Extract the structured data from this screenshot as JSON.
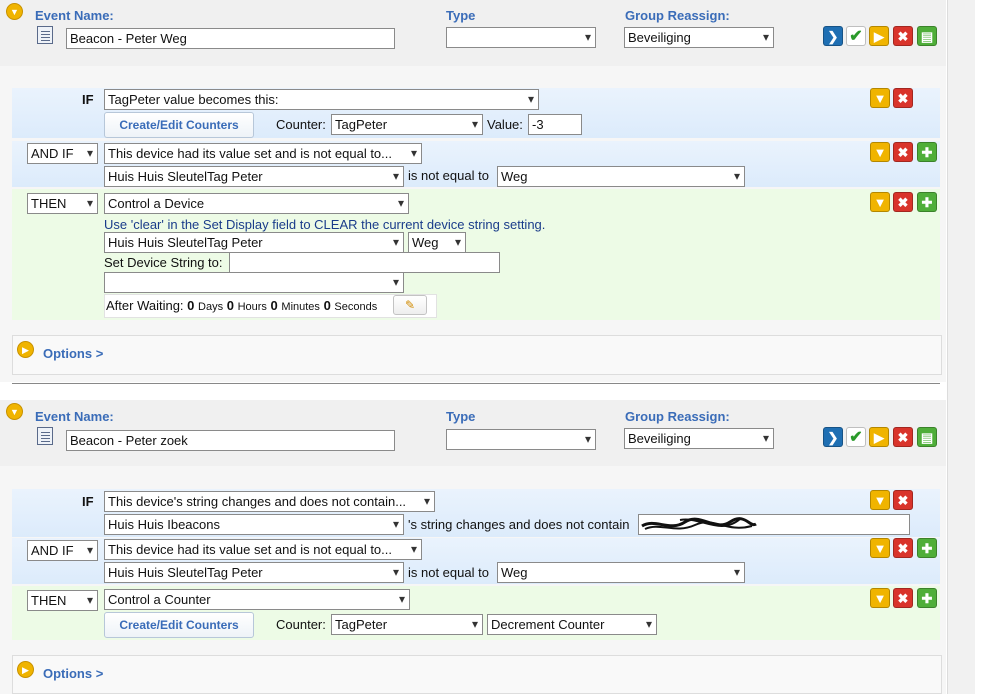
{
  "labels": {
    "event_name": "Event Name:",
    "type": "Type",
    "group_reassign": "Group Reassign:",
    "if": "IF",
    "create_edit_counters": "Create/Edit Counters",
    "counter": "Counter:",
    "value": "Value:",
    "is_not_equal_to": "is not equal to",
    "options": "Options >",
    "set_device_string_to": "Set Device String to:",
    "after_waiting": "After Waiting:",
    "days": "Days",
    "hours": "Hours",
    "minutes": "Minutes",
    "seconds": "Seconds",
    "string_not_contain": "'s string changes and does not contain"
  },
  "event1": {
    "name": "Beacon - Peter Weg",
    "type_value": "",
    "group_value": "Beveiliging",
    "if_condition": "TagPeter value becomes this:",
    "counter_value": "TagPeter",
    "counter_compare_value": "-3",
    "andif_operator": "AND IF",
    "andif_condition": "This device had its value set and is not equal to...",
    "andif_device": "Huis Huis SleutelTag Peter",
    "andif_value": "Weg",
    "then_operator": "THEN",
    "then_action": "Control a Device",
    "clear_note": "Use 'clear' in the Set Display field to CLEAR the current device string setting.",
    "action_device": "Huis Huis SleutelTag Peter",
    "action_value": "Weg",
    "device_string": "",
    "extra_select": "",
    "wait_days": "0",
    "wait_hours": "0",
    "wait_minutes": "0",
    "wait_seconds": "0"
  },
  "event2": {
    "name": "Beacon - Peter zoek",
    "type_value": "",
    "group_value": "Beveiliging",
    "if_condition": "This device's string changes and does not contain...",
    "if_device": "Huis Huis Ibeacons",
    "if_string": "",
    "andif_operator": "AND IF",
    "andif_condition": "This device had its value set and is not equal to...",
    "andif_device": "Huis Huis SleutelTag Peter",
    "andif_value": "Weg",
    "then_operator": "THEN",
    "then_action": "Control a Counter",
    "counter_value": "TagPeter",
    "counter_action": "Decrement Counter"
  },
  "icons": {
    "chevron": "▾",
    "run": "❯",
    "check": "✔",
    "play": "▶",
    "close": "✖",
    "move_down": "▼",
    "add": "✚",
    "copy": "▤",
    "pencil": "✎"
  },
  "colors": {
    "label_blue": "#3a6cb8",
    "red_button": "#d9342b",
    "yellow_button": "#f0b400",
    "green_button": "#3aa93a"
  }
}
